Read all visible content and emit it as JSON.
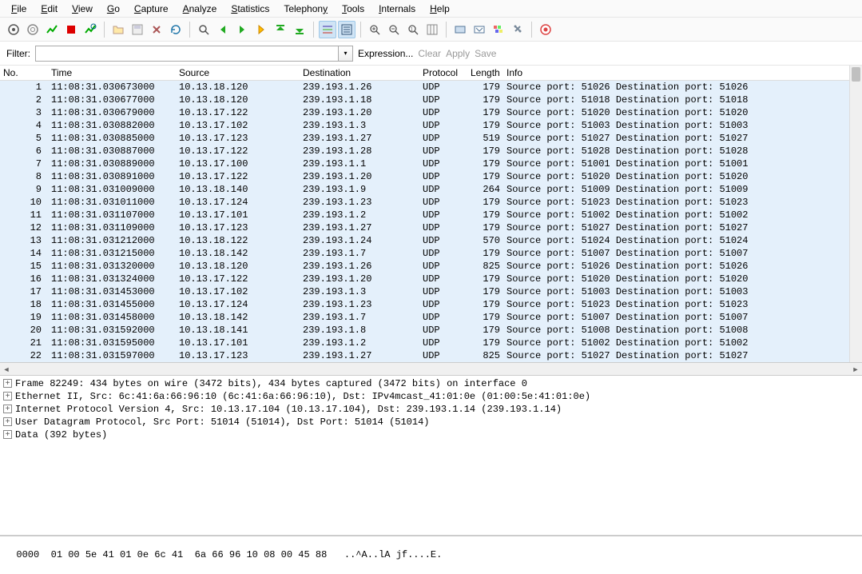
{
  "menu": {
    "items": [
      "File",
      "Edit",
      "View",
      "Go",
      "Capture",
      "Analyze",
      "Statistics",
      "Telephony",
      "Tools",
      "Internals",
      "Help"
    ]
  },
  "filter": {
    "label": "Filter:",
    "value": "",
    "expression": "Expression...",
    "clear": "Clear",
    "apply": "Apply",
    "save": "Save"
  },
  "columns": {
    "no": "No.",
    "time": "Time",
    "source": "Source",
    "destination": "Destination",
    "protocol": "Protocol",
    "length": "Length",
    "info": "Info"
  },
  "packets": [
    {
      "no": 1,
      "time": "11:08:31.030673000",
      "src": "10.13.18.120",
      "dst": "239.193.1.26",
      "proto": "UDP",
      "len": 179,
      "info": "Source port: 51026  Destination port: 51026"
    },
    {
      "no": 2,
      "time": "11:08:31.030677000",
      "src": "10.13.18.120",
      "dst": "239.193.1.18",
      "proto": "UDP",
      "len": 179,
      "info": "Source port: 51018  Destination port: 51018"
    },
    {
      "no": 3,
      "time": "11:08:31.030679000",
      "src": "10.13.17.122",
      "dst": "239.193.1.20",
      "proto": "UDP",
      "len": 179,
      "info": "Source port: 51020  Destination port: 51020"
    },
    {
      "no": 4,
      "time": "11:08:31.030882000",
      "src": "10.13.17.102",
      "dst": "239.193.1.3",
      "proto": "UDP",
      "len": 179,
      "info": "Source port: 51003  Destination port: 51003"
    },
    {
      "no": 5,
      "time": "11:08:31.030885000",
      "src": "10.13.17.123",
      "dst": "239.193.1.27",
      "proto": "UDP",
      "len": 519,
      "info": "Source port: 51027  Destination port: 51027"
    },
    {
      "no": 6,
      "time": "11:08:31.030887000",
      "src": "10.13.17.122",
      "dst": "239.193.1.28",
      "proto": "UDP",
      "len": 179,
      "info": "Source port: 51028  Destination port: 51028"
    },
    {
      "no": 7,
      "time": "11:08:31.030889000",
      "src": "10.13.17.100",
      "dst": "239.193.1.1",
      "proto": "UDP",
      "len": 179,
      "info": "Source port: 51001  Destination port: 51001"
    },
    {
      "no": 8,
      "time": "11:08:31.030891000",
      "src": "10.13.17.122",
      "dst": "239.193.1.20",
      "proto": "UDP",
      "len": 179,
      "info": "Source port: 51020  Destination port: 51020"
    },
    {
      "no": 9,
      "time": "11:08:31.031009000",
      "src": "10.13.18.140",
      "dst": "239.193.1.9",
      "proto": "UDP",
      "len": 264,
      "info": "Source port: 51009  Destination port: 51009"
    },
    {
      "no": 10,
      "time": "11:08:31.031011000",
      "src": "10.13.17.124",
      "dst": "239.193.1.23",
      "proto": "UDP",
      "len": 179,
      "info": "Source port: 51023  Destination port: 51023"
    },
    {
      "no": 11,
      "time": "11:08:31.031107000",
      "src": "10.13.17.101",
      "dst": "239.193.1.2",
      "proto": "UDP",
      "len": 179,
      "info": "Source port: 51002  Destination port: 51002"
    },
    {
      "no": 12,
      "time": "11:08:31.031109000",
      "src": "10.13.17.123",
      "dst": "239.193.1.27",
      "proto": "UDP",
      "len": 179,
      "info": "Source port: 51027  Destination port: 51027"
    },
    {
      "no": 13,
      "time": "11:08:31.031212000",
      "src": "10.13.18.122",
      "dst": "239.193.1.24",
      "proto": "UDP",
      "len": 570,
      "info": "Source port: 51024  Destination port: 51024"
    },
    {
      "no": 14,
      "time": "11:08:31.031215000",
      "src": "10.13.18.142",
      "dst": "239.193.1.7",
      "proto": "UDP",
      "len": 179,
      "info": "Source port: 51007  Destination port: 51007"
    },
    {
      "no": 15,
      "time": "11:08:31.031320000",
      "src": "10.13.18.120",
      "dst": "239.193.1.26",
      "proto": "UDP",
      "len": 825,
      "info": "Source port: 51026  Destination port: 51026"
    },
    {
      "no": 16,
      "time": "11:08:31.031324000",
      "src": "10.13.17.122",
      "dst": "239.193.1.20",
      "proto": "UDP",
      "len": 179,
      "info": "Source port: 51020  Destination port: 51020"
    },
    {
      "no": 17,
      "time": "11:08:31.031453000",
      "src": "10.13.17.102",
      "dst": "239.193.1.3",
      "proto": "UDP",
      "len": 179,
      "info": "Source port: 51003  Destination port: 51003"
    },
    {
      "no": 18,
      "time": "11:08:31.031455000",
      "src": "10.13.17.124",
      "dst": "239.193.1.23",
      "proto": "UDP",
      "len": 179,
      "info": "Source port: 51023  Destination port: 51023"
    },
    {
      "no": 19,
      "time": "11:08:31.031458000",
      "src": "10.13.18.142",
      "dst": "239.193.1.7",
      "proto": "UDP",
      "len": 179,
      "info": "Source port: 51007  Destination port: 51007"
    },
    {
      "no": 20,
      "time": "11:08:31.031592000",
      "src": "10.13.18.141",
      "dst": "239.193.1.8",
      "proto": "UDP",
      "len": 179,
      "info": "Source port: 51008  Destination port: 51008"
    },
    {
      "no": 21,
      "time": "11:08:31.031595000",
      "src": "10.13.17.101",
      "dst": "239.193.1.2",
      "proto": "UDP",
      "len": 179,
      "info": "Source port: 51002  Destination port: 51002"
    },
    {
      "no": 22,
      "time": "11:08:31.031597000",
      "src": "10.13.17.123",
      "dst": "239.193.1.27",
      "proto": "UDP",
      "len": 825,
      "info": "Source port: 51027  Destination port: 51027"
    }
  ],
  "detail": {
    "lines": [
      "Frame 82249: 434 bytes on wire (3472 bits), 434 bytes captured (3472 bits) on interface 0",
      "Ethernet II, Src: 6c:41:6a:66:96:10 (6c:41:6a:66:96:10), Dst: IPv4mcast_41:01:0e (01:00:5e:41:01:0e)",
      "Internet Protocol Version 4, Src: 10.13.17.104 (10.13.17.104), Dst: 239.193.1.14 (239.193.1.14)",
      "User Datagram Protocol, Src Port: 51014 (51014), Dst Port: 51014 (51014)",
      "Data (392 bytes)"
    ]
  },
  "hex": {
    "offset": "0000",
    "bytes": "01 00 5e 41 01 0e 6c 41  6a 66 96 10 08 00 45 88",
    "ascii": "..^A..lA jf....E."
  }
}
